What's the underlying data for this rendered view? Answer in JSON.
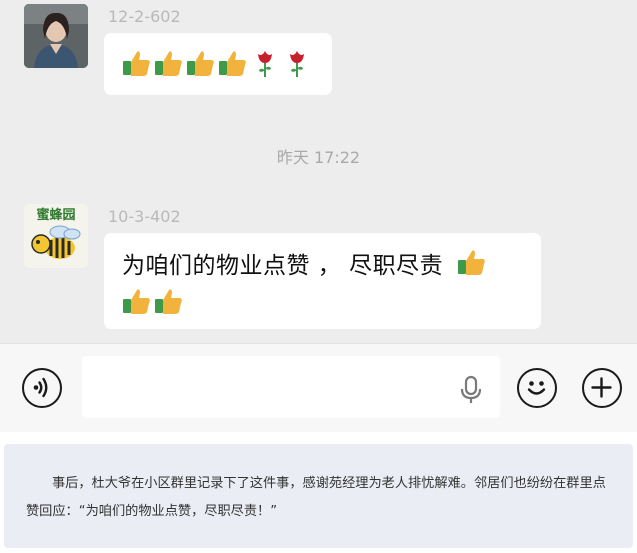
{
  "chat": {
    "timestamp": "昨天 17:22",
    "messages": [
      {
        "sender": "12-2-602",
        "avatar_icon": "woman-portrait-avatar",
        "emojis": [
          "thumbs-up",
          "thumbs-up",
          "thumbs-up",
          "thumbs-up",
          "rose",
          "rose"
        ]
      },
      {
        "sender": "10-3-402",
        "avatar_icon": "bee-logo-avatar",
        "avatar_text": "蜜蜂园",
        "text": "为咱们的物业点赞 ， 尽职尽责",
        "emojis_line1": [
          "thumbs-up"
        ],
        "emojis_line2": [
          "thumbs-up",
          "thumbs-up"
        ]
      }
    ]
  },
  "input_bar": {
    "voice_icon": "voice-icon",
    "input_value": "",
    "mic_icon": "microphone-icon",
    "emoji_icon": "smiley-icon",
    "plus_icon": "plus-icon"
  },
  "caption": {
    "text": "事后，杜大爷在小区群里记录下了这件事，感谢苑经理为老人排忧解难。邻居们也纷纷在群里点赞回应：“为咱们的物业点赞，尽职尽责！”"
  },
  "colors": {
    "chat_bg": "#ededed",
    "bubble_bg": "#ffffff",
    "thumb": "#f2b33d",
    "cuff": "#3e9a48",
    "rose": "#c8202a",
    "caption_bg": "#eaeef4"
  }
}
